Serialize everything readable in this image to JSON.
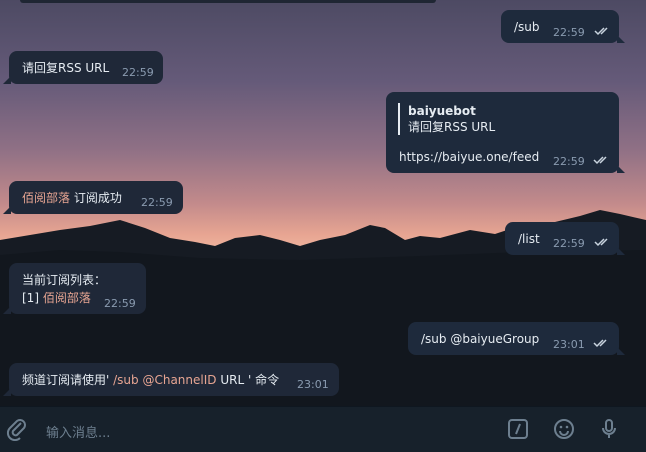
{
  "messages": [
    {
      "id": "m1",
      "dir": "out",
      "text": "/sub",
      "time": "22:59"
    },
    {
      "id": "m2",
      "dir": "in",
      "text": "请回复RSS URL",
      "time": "22:59"
    },
    {
      "id": "m3",
      "dir": "out",
      "quote_author": "baiyuebot",
      "quote_text": "请回复RSS URL",
      "text": "https://baiyue.one/feed",
      "time": "22:59"
    },
    {
      "id": "m4",
      "dir": "in",
      "link": "佰阅部落",
      "text": " 订阅成功",
      "time": "22:59"
    },
    {
      "id": "m5",
      "dir": "out",
      "text": "/list",
      "time": "22:59"
    },
    {
      "id": "m6",
      "dir": "in",
      "line1": "当前订阅列表：",
      "line2_prefix": "[1] ",
      "line2_link": "佰阅部落",
      "time": "22:59"
    },
    {
      "id": "m7",
      "dir": "out",
      "text": "/sub @baiyueGroup",
      "time": "23:01"
    },
    {
      "id": "m8",
      "dir": "in",
      "prefix": "频道订阅请使用' ",
      "cmd": "/sub @ChannelID",
      "suffix": " URL ' 命令",
      "time": "23:01"
    }
  ],
  "composer": {
    "placeholder": "输入消息...",
    "icons": [
      "paperclip-icon",
      "bot-command-icon",
      "emoji-icon",
      "microphone-icon"
    ]
  },
  "colors": {
    "accent": "#e7a592",
    "bubble": "#1f2838",
    "time": "#8a9bb0",
    "composer": "#17212b"
  }
}
